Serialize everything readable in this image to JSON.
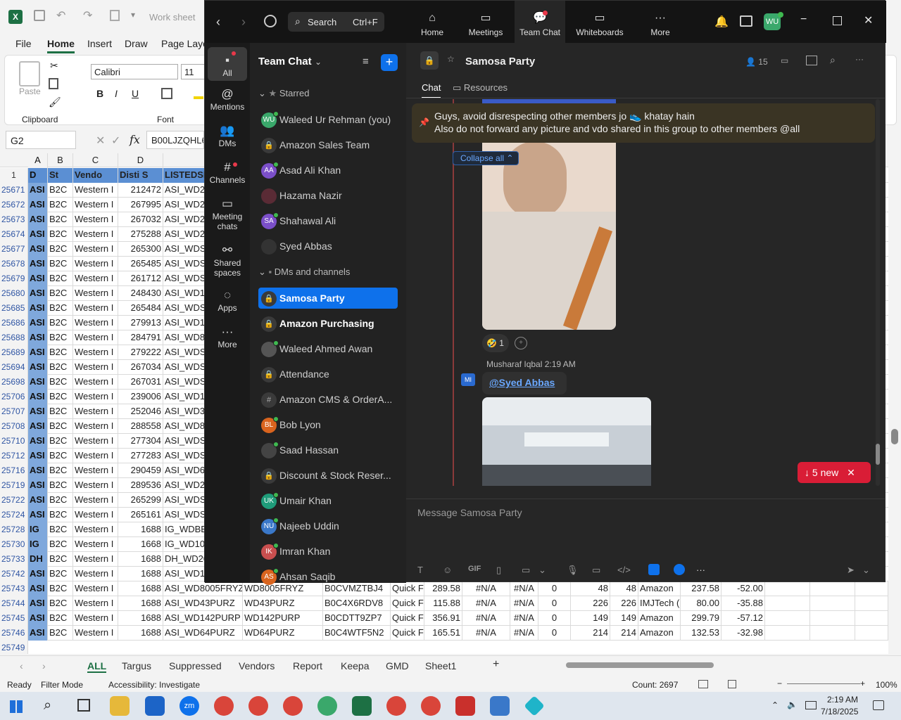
{
  "excel": {
    "title": "Work sheet",
    "tabs": [
      "File",
      "Home",
      "Insert",
      "Draw",
      "Page Layo"
    ],
    "font_name": "Calibri",
    "font_size": "11",
    "groups": {
      "clipboard": "Clipboard",
      "font": "Font",
      "paste": "Paste"
    },
    "name_box": "G2",
    "formula": "B00LJZQHL6",
    "col_letters": [
      "A",
      "B",
      "C",
      "D"
    ],
    "headers": [
      "D",
      "St",
      "Vendo",
      "Disti S",
      "LISTEDSI"
    ],
    "rows": [
      [
        "25671",
        "ASI",
        "B2C",
        "Western I",
        "212472",
        "ASI_WD2"
      ],
      [
        "25672",
        "ASI",
        "B2C",
        "Western I",
        "267995",
        "ASI_WD2"
      ],
      [
        "25673",
        "ASI",
        "B2C",
        "Western I",
        "267032",
        "ASI_WD2"
      ],
      [
        "25674",
        "ASI",
        "B2C",
        "Western I",
        "275288",
        "ASI_WD2"
      ],
      [
        "25677",
        "ASI",
        "B2C",
        "Western I",
        "265300",
        "ASI_WDS"
      ],
      [
        "25678",
        "ASI",
        "B2C",
        "Western I",
        "265485",
        "ASI_WDS"
      ],
      [
        "25679",
        "ASI",
        "B2C",
        "Western I",
        "261712",
        "ASI_WDS"
      ],
      [
        "25680",
        "ASI",
        "B2C",
        "Western I",
        "248430",
        "ASI_WD1"
      ],
      [
        "25685",
        "ASI",
        "B2C",
        "Western I",
        "265484",
        "ASI_WDS"
      ],
      [
        "25686",
        "ASI",
        "B2C",
        "Western I",
        "279913",
        "ASI_WD1"
      ],
      [
        "25688",
        "ASI",
        "B2C",
        "Western I",
        "284791",
        "ASI_WD8"
      ],
      [
        "25689",
        "ASI",
        "B2C",
        "Western I",
        "279222",
        "ASI_WDS"
      ],
      [
        "25694",
        "ASI",
        "B2C",
        "Western I",
        "267034",
        "ASI_WDS"
      ],
      [
        "25698",
        "ASI",
        "B2C",
        "Western I",
        "267031",
        "ASI_WDS"
      ],
      [
        "25706",
        "ASI",
        "B2C",
        "Western I",
        "239006",
        "ASI_WD1"
      ],
      [
        "25707",
        "ASI",
        "B2C",
        "Western I",
        "252046",
        "ASI_WD3"
      ],
      [
        "25708",
        "ASI",
        "B2C",
        "Western I",
        "288558",
        "ASI_WD8"
      ],
      [
        "25710",
        "ASI",
        "B2C",
        "Western I",
        "277304",
        "ASI_WDS"
      ],
      [
        "25712",
        "ASI",
        "B2C",
        "Western I",
        "277283",
        "ASI_WDS"
      ],
      [
        "25716",
        "ASI",
        "B2C",
        "Western I",
        "290459",
        "ASI_WD6"
      ],
      [
        "25719",
        "ASI",
        "B2C",
        "Western I",
        "289536",
        "ASI_WD2"
      ],
      [
        "25722",
        "ASI",
        "B2C",
        "Western I",
        "265299",
        "ASI_WDS"
      ],
      [
        "25724",
        "ASI",
        "B2C",
        "Western I",
        "265161",
        "ASI_WDS"
      ],
      [
        "25728",
        "IG",
        "B2C",
        "Western I",
        "1688",
        "IG_WDBB"
      ],
      [
        "25730",
        "IG",
        "B2C",
        "Western I",
        "1668",
        "IG_WD10"
      ],
      [
        "25733",
        "DH",
        "B2C",
        "Western I",
        "1688",
        "DH_WD20"
      ],
      [
        "25742",
        "ASI",
        "B2C",
        "Western I",
        "1688",
        "ASI_WD1"
      ]
    ],
    "full_rows": [
      [
        "25743",
        "ASI",
        "B2C",
        "Western I",
        "1688",
        "ASI_WD8005FRYZ",
        "WD8005FRYZ",
        "B0CVMZTBJ4",
        "Quick F",
        "289.58",
        "#N/A",
        "#N/A",
        "0",
        "48",
        "48",
        "Amazon",
        "237.58",
        "-52.00"
      ],
      [
        "25744",
        "ASI",
        "B2C",
        "Western I",
        "1688",
        "ASI_WD43PURZ",
        "WD43PURZ",
        "B0C4X6RDV8",
        "Quick F",
        "115.88",
        "#N/A",
        "#N/A",
        "0",
        "226",
        "226",
        "IMJTech (:",
        "80.00",
        "-35.88"
      ],
      [
        "25745",
        "ASI",
        "B2C",
        "Western I",
        "1688",
        "ASI_WD142PURP",
        "WD142PURP",
        "B0CDTT9ZP7",
        "Quick F",
        "356.91",
        "#N/A",
        "#N/A",
        "0",
        "149",
        "149",
        "Amazon",
        "299.79",
        "-57.12"
      ],
      [
        "25746",
        "ASI",
        "B2C",
        "Western I",
        "1688",
        "ASI_WD64PURZ",
        "WD64PURZ",
        "B0C4WTF5N2",
        "Quick F",
        "165.51",
        "#N/A",
        "#N/A",
        "0",
        "214",
        "214",
        "Amazon",
        "132.53",
        "-32.98"
      ]
    ],
    "last_row": "25749",
    "row1": "1",
    "sheet_tabs": [
      "ALL",
      "Targus",
      "Suppressed",
      "Vendors",
      "Report",
      "Keepa",
      "GMD",
      "Sheet1"
    ],
    "status": {
      "ready": "Ready",
      "filter": "Filter Mode",
      "access": "Accessibility: Investigate",
      "count": "Count: 2697",
      "zoom": "100%"
    }
  },
  "teams": {
    "search": "Search",
    "shortcut": "Ctrl+F",
    "nav": [
      "Home",
      "Meetings",
      "Team Chat",
      "Whiteboards",
      "More"
    ],
    "me": "WU",
    "rail": [
      "All",
      "Mentions",
      "DMs",
      "Channels",
      "Meeting chats",
      "Shared spaces",
      "Apps",
      "More"
    ],
    "list_title": "Team Chat",
    "starred": "Starred",
    "dms_channels": "DMs and channels",
    "starred_items": [
      {
        "n": "Waleed Ur Rehman (you)",
        "a": "WU",
        "c": "#3aa86b"
      },
      {
        "n": "Amazon Sales Team",
        "a": "",
        "c": ""
      },
      {
        "n": "Asad Ali Khan",
        "a": "AA",
        "c": "#7b4fc9"
      },
      {
        "n": "Hazama Nazir",
        "a": "",
        "c": "#5a2b35"
      },
      {
        "n": "Shahawal Ali",
        "a": "SA",
        "c": "#7b4fc9"
      },
      {
        "n": "Syed Abbas",
        "a": "",
        "c": "#333"
      }
    ],
    "channel_items": [
      {
        "n": "Samosa Party",
        "a": "",
        "c": ""
      },
      {
        "n": "Amazon Purchasing",
        "a": "",
        "c": ""
      },
      {
        "n": "Waleed Ahmed Awan",
        "a": "",
        "c": "#555"
      },
      {
        "n": "Attendance",
        "a": "",
        "c": ""
      },
      {
        "n": "Amazon CMS & OrderA...",
        "a": "#",
        "c": ""
      },
      {
        "n": "Bob Lyon",
        "a": "BL",
        "c": "#d9641e"
      },
      {
        "n": "Saad Hassan",
        "a": "",
        "c": "#444"
      },
      {
        "n": "Discount & Stock Reser...",
        "a": "",
        "c": ""
      },
      {
        "n": "Umair Khan",
        "a": "UK",
        "c": "#1f9c7a"
      },
      {
        "n": "Najeeb Uddin",
        "a": "NU",
        "c": "#3a78c9"
      },
      {
        "n": "Imran Khan",
        "a": "IK",
        "c": "#c94f4f"
      },
      {
        "n": "Ahsan Saqib",
        "a": "AS",
        "c": "#d9641e"
      }
    ],
    "chat": {
      "name": "Samosa Party",
      "members": "15",
      "tabs": [
        "Chat",
        "Resources"
      ],
      "pinned1": "Guys, avoid disrespecting other members jo 👟 khatay hain",
      "pinned2": "Also do not forward any picture and vdo shared in this group to other members @all",
      "collapse": "Collapse all",
      "reaction": "1",
      "sender": "Musharaf Iqbal",
      "time": "2:19 AM",
      "sender_av": "MI",
      "mention": "@Syed Abbas",
      "new_badge": "5 new",
      "composer": "Message Samosa Party"
    }
  },
  "taskbar": {
    "time": "2:19 AM",
    "date": "7/18/2025"
  }
}
